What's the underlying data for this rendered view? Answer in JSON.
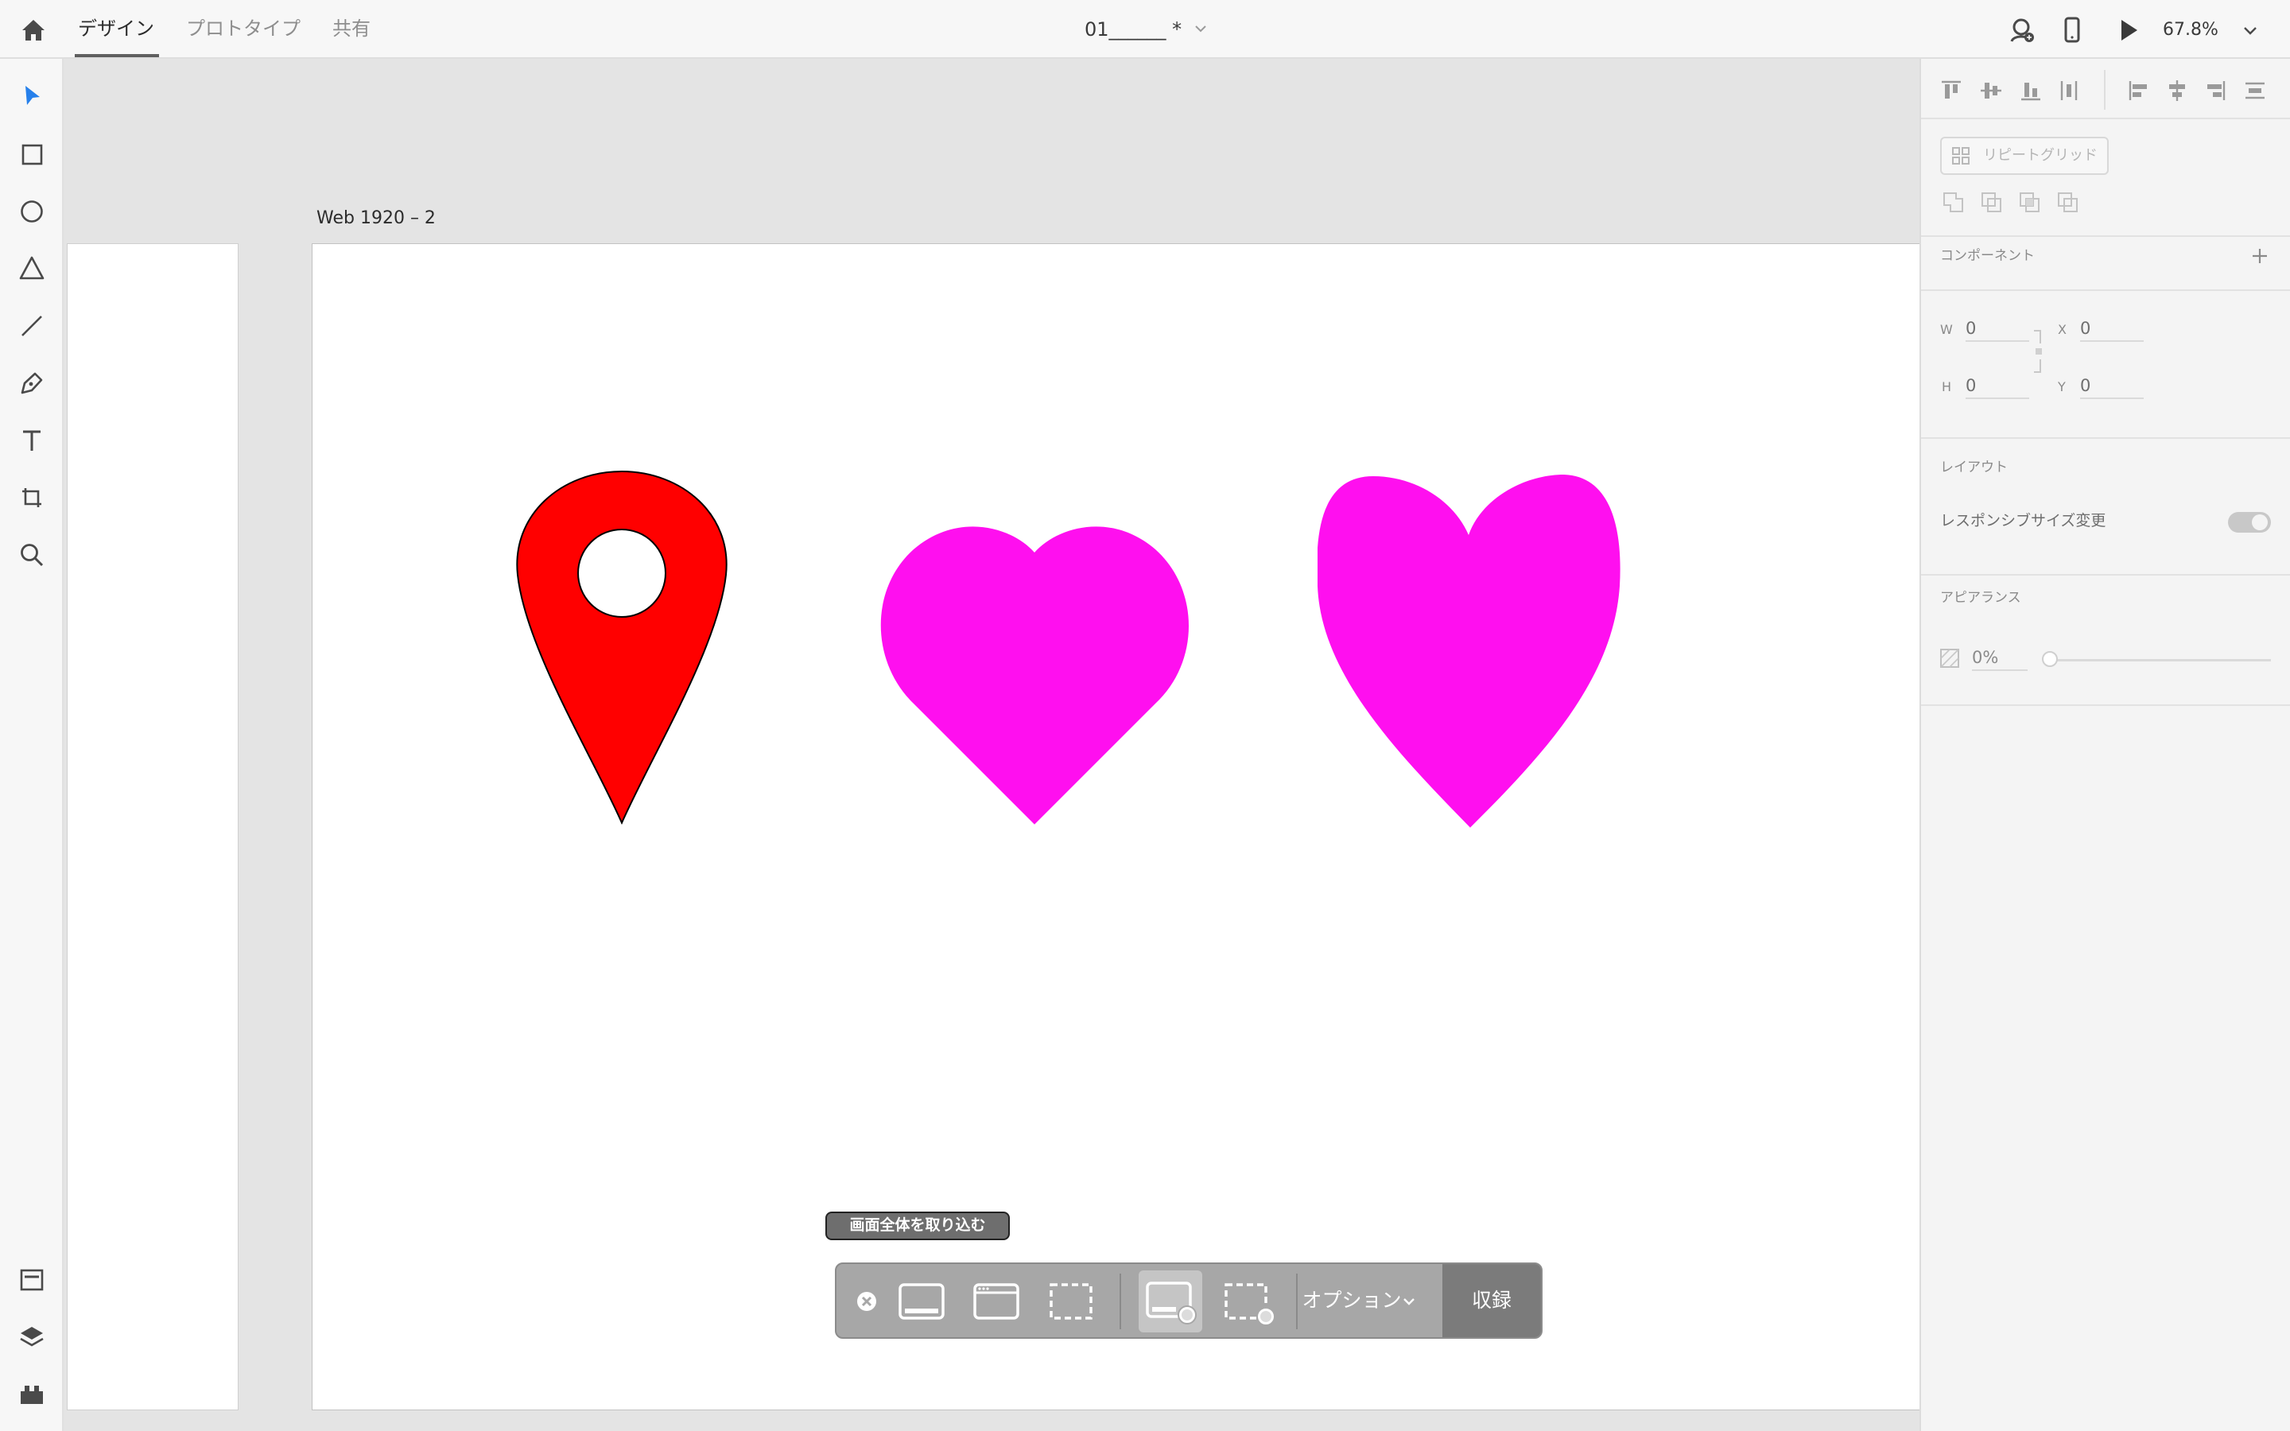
{
  "topbar": {
    "tabs": [
      {
        "label": "デザイン",
        "active": true
      },
      {
        "label": "プロトタイプ",
        "active": false
      },
      {
        "label": "共有",
        "active": false
      }
    ],
    "document_title": "01______ *",
    "zoom": "67.8%",
    "icons": [
      "home-icon",
      "share-user-icon",
      "device-preview-icon",
      "play-icon",
      "chevron-down-icon"
    ]
  },
  "tools": [
    "select-icon",
    "rectangle-icon",
    "ellipse-icon",
    "polygon-icon",
    "line-icon",
    "pen-icon",
    "text-icon",
    "artboard-icon",
    "zoom-icon",
    "document-assets-icon",
    "layers-icon",
    "plugins-icon"
  ],
  "canvas": {
    "artboard_label": "Web 1920 – 2",
    "shapes": [
      {
        "name": "map-pin",
        "fill": "#ff0000",
        "stroke": "#000000"
      },
      {
        "name": "heart-1",
        "fill": "#ff0fef"
      },
      {
        "name": "heart-2",
        "fill": "#ff0fef"
      }
    ]
  },
  "capture_toolbar": {
    "tooltip": "画面全体を取り込む",
    "options_label": "オプション",
    "record_label": "収録",
    "buttons": [
      "close-icon",
      "capture-entire-screen-icon",
      "capture-window-icon",
      "capture-selection-icon",
      "record-entire-screen-icon",
      "record-selection-icon"
    ]
  },
  "panel": {
    "repeat_grid": "リピートグリッド",
    "component_title": "コンポーネント",
    "w_label": "W",
    "w_value": "0",
    "h_label": "H",
    "h_value": "0",
    "x_label": "X",
    "x_value": "0",
    "y_label": "Y",
    "y_value": "0",
    "layout_title": "レイアウト",
    "responsive_label": "レスポンシブサイズ変更",
    "responsive_on": true,
    "appearance_title": "アピアランス",
    "opacity": "0%"
  },
  "colors": {
    "accent": "#2680eb",
    "pin_red": "#ff0000",
    "heart_magenta": "#ff0fef"
  }
}
